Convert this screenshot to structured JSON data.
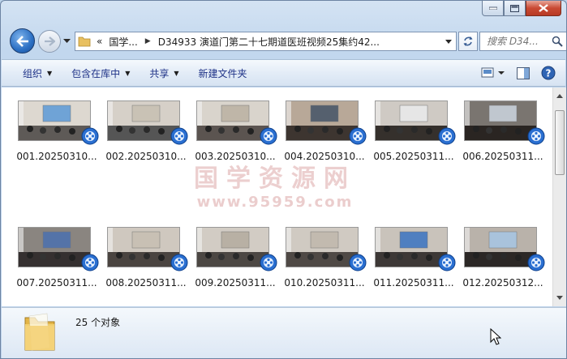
{
  "window": {
    "caption": {
      "minimize": "minimize",
      "maximize": "maximize",
      "close": "close"
    }
  },
  "address": {
    "crumbs": [
      "«",
      "国学...",
      "D34933 演道门第二十七期道医班视频25集约42..."
    ],
    "search_placeholder": "搜索 D34..."
  },
  "toolbar": {
    "organize": "组织",
    "include_in_library": "包含在库中",
    "share": "共享",
    "new_folder": "新建文件夹"
  },
  "files": [
    {
      "name": "001.20250310..."
    },
    {
      "name": "002.20250310..."
    },
    {
      "name": "003.20250310..."
    },
    {
      "name": "004.20250310..."
    },
    {
      "name": "005.20250311..."
    },
    {
      "name": "006.20250311..."
    },
    {
      "name": "007.20250311..."
    },
    {
      "name": "008.20250311..."
    },
    {
      "name": "009.20250311..."
    },
    {
      "name": "010.20250311..."
    },
    {
      "name": "011.20250311..."
    },
    {
      "name": "012.20250312..."
    }
  ],
  "watermark": {
    "main": "国学资源网",
    "url": "www.95959.com"
  },
  "details": {
    "count": "25 个对象"
  },
  "colors": {
    "accent": "#1e3287",
    "close": "#c94a33",
    "watermark": "#e9c7c7"
  }
}
